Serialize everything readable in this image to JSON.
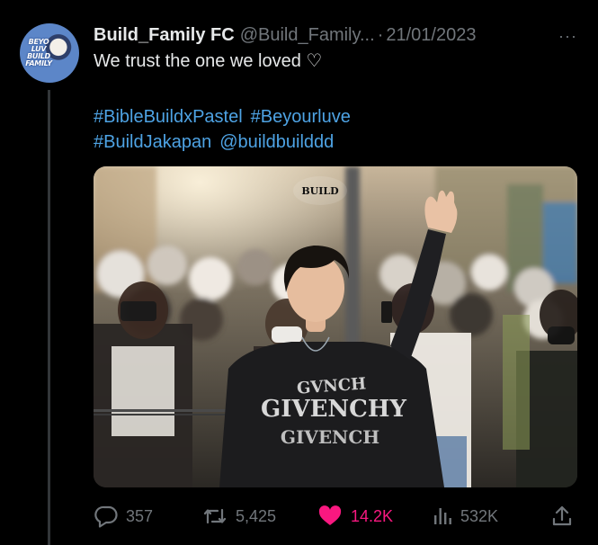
{
  "tweet": {
    "avatar": {
      "lines": [
        "BEYO",
        "LUV",
        "BUILD",
        "FAMILY"
      ]
    },
    "author_name": "Build_Family FC",
    "handle": "@Build_Family...",
    "separator": "·",
    "date": "21/01/2023",
    "more_label": "···",
    "text": "We trust the one we loved ♡",
    "hashtags": [
      "#BibleBuildxPastel",
      "#Beyourluve",
      "#BuildJakapan",
      "@buildbuilddd"
    ],
    "media": {
      "watermark": "BUILD",
      "shirt_text": "GIVENCHY"
    },
    "actions": {
      "replies": "357",
      "reposts": "5,425",
      "likes": "14.2K",
      "views": "532K"
    },
    "colors": {
      "background": "#000000",
      "text": "#e7e9ea",
      "muted": "#71767b",
      "link": "#4ea3e4",
      "like": "#f91880"
    }
  }
}
